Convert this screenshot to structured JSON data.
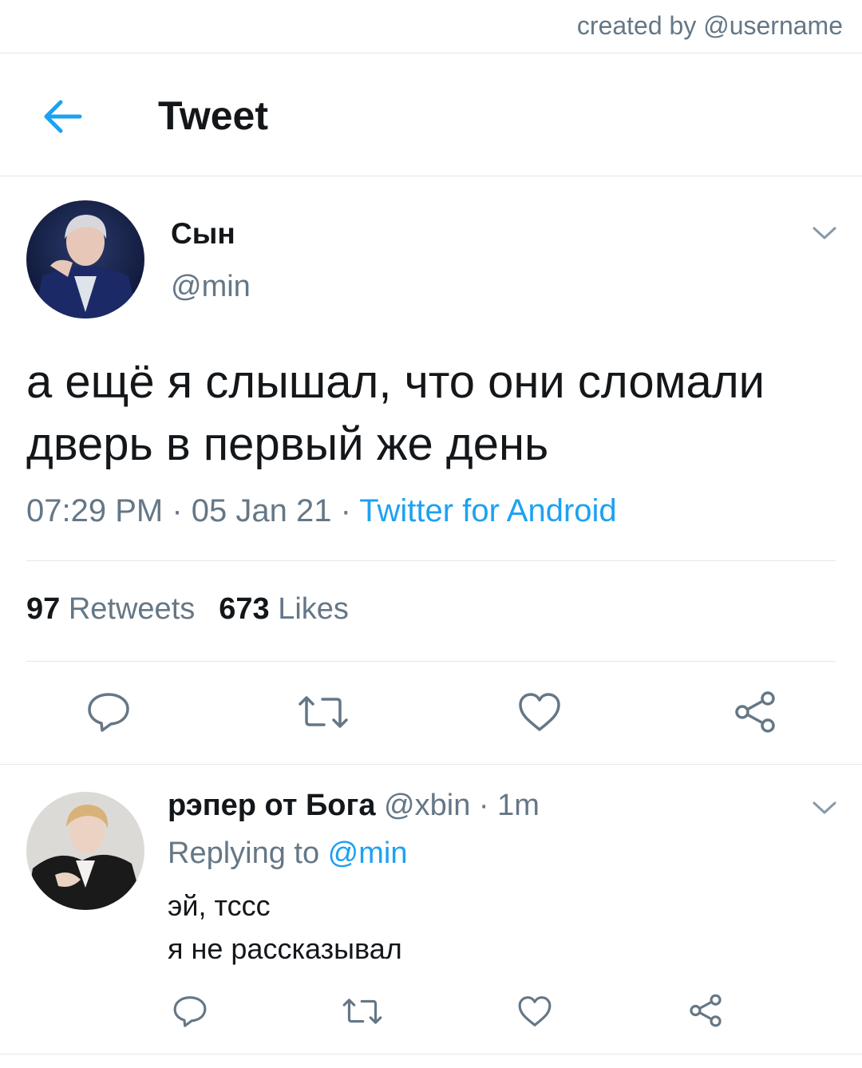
{
  "credit": "created by @username",
  "header": {
    "title": "Tweet",
    "back_icon": "arrow-left-icon"
  },
  "tweet": {
    "author_name": "Сын",
    "author_handle": "@min",
    "text": "а ещё я слышал, что они сломали дверь в первый же день",
    "time": "07:29 PM",
    "sep1": " · ",
    "date": "05 Jan 21",
    "sep2": " · ",
    "source": "Twitter for Android",
    "retweets_count": "97",
    "retweets_label": "Retweets",
    "likes_count": "673",
    "likes_label": "Likes"
  },
  "reply": {
    "author_name": "рэпер от Бога",
    "author_handle": "@xbin",
    "time": " · 1m",
    "replying_label": "Replying to ",
    "replying_to": "@min",
    "text": "эй, тссс\nя не рассказывал"
  },
  "colors": {
    "accent": "#1da1f2",
    "secondary": "#657786",
    "divider": "#e1e8ed",
    "icon": "#657786"
  },
  "icons": [
    "arrow-left-icon",
    "chevron-down-icon",
    "reply-icon",
    "retweet-icon",
    "like-icon",
    "share-icon"
  ]
}
